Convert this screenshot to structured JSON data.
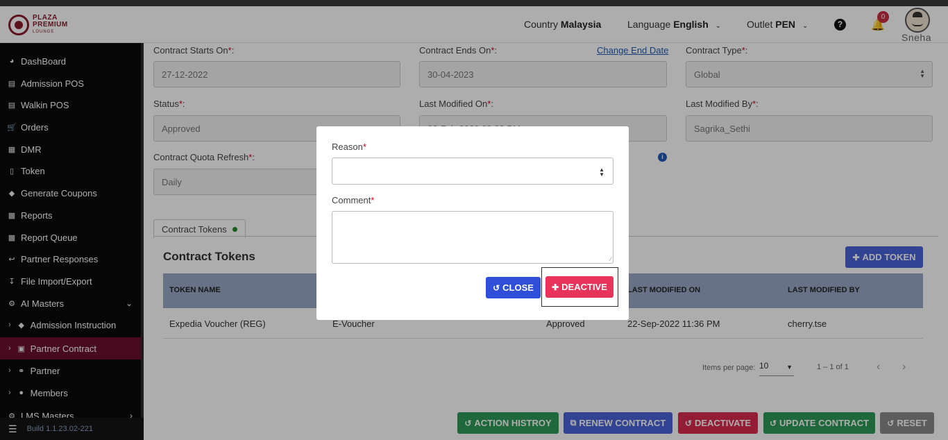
{
  "header": {
    "logo": {
      "line1": "PLAZA",
      "line2": "PREMIUM",
      "line3": "LOUNGE"
    },
    "country_label": "Country",
    "country_value": "Malaysia",
    "language_label": "Language",
    "language_value": "English",
    "outlet_label": "Outlet",
    "outlet_value": "PEN",
    "notification_count": "0",
    "user_name": "Sneha"
  },
  "sidebar": {
    "items": [
      {
        "label": "DashBoard",
        "icon": "dashboard-icon"
      },
      {
        "label": "Admission POS",
        "icon": "id-card-icon"
      },
      {
        "label": "Walkin POS",
        "icon": "id-card-icon"
      },
      {
        "label": "Orders",
        "icon": "cart-icon"
      },
      {
        "label": "DMR",
        "icon": "calendar-icon"
      },
      {
        "label": "Token",
        "icon": "file-icon"
      },
      {
        "label": "Generate Coupons",
        "icon": "ticket-icon"
      },
      {
        "label": "Reports",
        "icon": "book-icon"
      },
      {
        "label": "Report Queue",
        "icon": "book-icon"
      },
      {
        "label": "Partner Responses",
        "icon": "reply-icon"
      },
      {
        "label": "File Import/Export",
        "icon": "download-icon"
      },
      {
        "label": "AI Masters",
        "icon": "sitemap-icon"
      },
      {
        "label": "Admission Instruction",
        "icon": "tag-icon"
      },
      {
        "label": "Partner Contract",
        "icon": "briefcase-icon"
      },
      {
        "label": "Partner",
        "icon": "handshake-icon"
      },
      {
        "label": "Members",
        "icon": "users-icon"
      },
      {
        "label": "LMS Masters",
        "icon": "sitemap-icon"
      }
    ],
    "build": "Build 1.1.23.02-221"
  },
  "form": {
    "contract_starts_label": "Contract Starts On",
    "contract_starts_value": "27-12-2022",
    "contract_ends_label": "Contract Ends On",
    "contract_ends_value": "30-04-2023",
    "change_end_date": "Change End Date",
    "contract_type_label": "Contract Type",
    "contract_type_value": "Global",
    "status_label": "Status",
    "status_value": "Approved",
    "last_modified_on_label": "Last Modified On",
    "last_modified_on_value": "22-Feb-2023 03:33 PM",
    "last_modified_by_label": "Last Modified By",
    "last_modified_by_value": "Sagrika_Sethi",
    "quota_refresh_label": "Contract Quota Refresh",
    "quota_refresh_value": "Daily",
    "required_mark": "*"
  },
  "tokens": {
    "tab_label": "Contract Tokens",
    "title": "Contract Tokens",
    "add_button": "ADD TOKEN",
    "columns": {
      "name": "TOKEN NAME",
      "last_modified_on": "LAST MODIFIED ON",
      "last_modified_by": "LAST MODIFIED BY"
    },
    "rows": [
      {
        "name": "Expedia Voucher (REG)",
        "type": "E-Voucher",
        "status": "Approved",
        "modified_on": "22-Sep-2022 11:36 PM",
        "modified_by": "cherry.tse"
      }
    ],
    "paginator": {
      "items_per_page_label": "Items per page:",
      "page_size": "10",
      "range": "1 – 1 of 1"
    }
  },
  "actions": {
    "history": "ACTION HISTROY",
    "renew": "RENEW CONTRACT",
    "deactivate": "DEACTIVATE",
    "update": "UPDATE CONTRACT",
    "reset": "RESET"
  },
  "modal": {
    "reason_label": "Reason",
    "comment_label": "Comment",
    "required_mark": "*",
    "close_button": "CLOSE",
    "deactive_button": "DEACTIVE"
  },
  "colors": {
    "brand": "#8a1c2b",
    "sidebar_active": "#6b0f2e",
    "primary": "#4a63d9",
    "success": "#2f9a59",
    "danger": "#e8335a"
  }
}
